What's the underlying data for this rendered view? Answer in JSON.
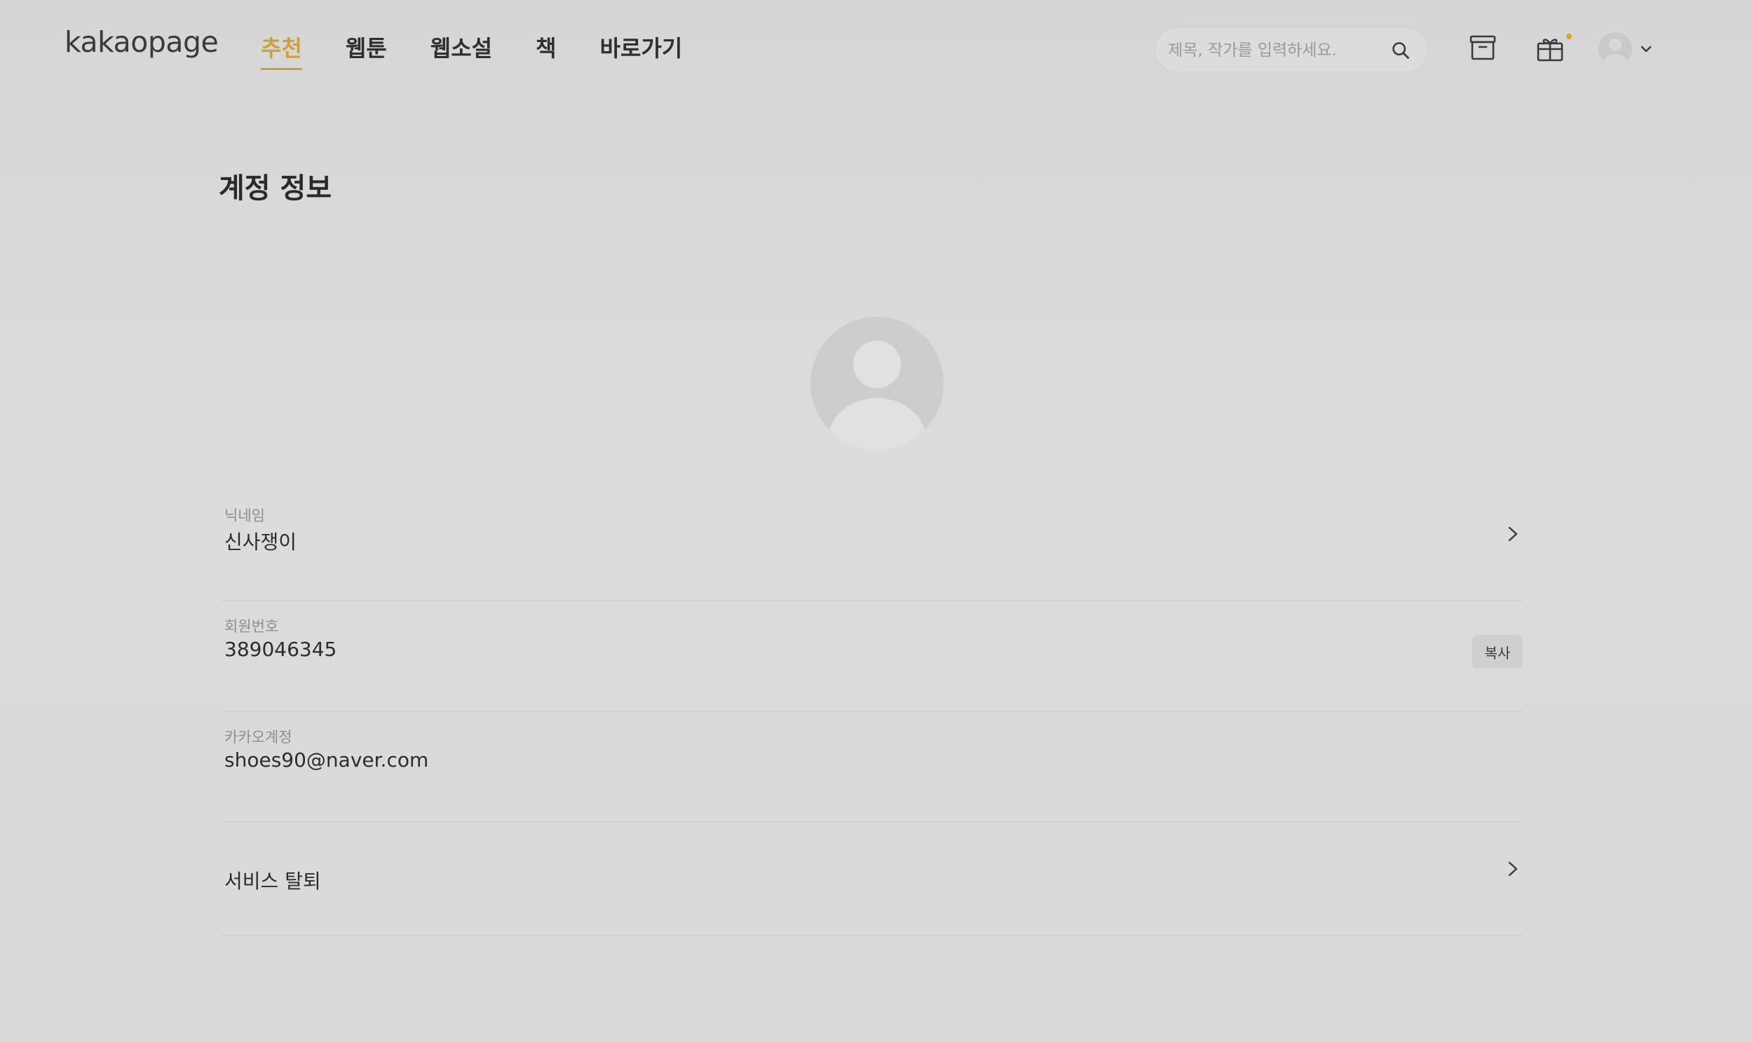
{
  "header": {
    "logo": "kakaopage",
    "nav": [
      {
        "label": "추천",
        "active": true
      },
      {
        "label": "웹툰",
        "active": false
      },
      {
        "label": "웹소설",
        "active": false
      },
      {
        "label": "책",
        "active": false
      },
      {
        "label": "바로가기",
        "active": false
      }
    ],
    "search": {
      "placeholder": "제목, 작가를 입력하세요.",
      "icon": "search-icon"
    },
    "icons": [
      "archive-icon",
      "gift-icon",
      "avatar",
      "chevron-down-icon"
    ]
  },
  "page": {
    "title": "계정 정보"
  },
  "account": {
    "nickname": {
      "label": "닉네임",
      "value": "신사쟁이"
    },
    "member_no": {
      "label": "회원번호",
      "value": "389046345",
      "copy_label": "복사"
    },
    "kakao": {
      "label": "카카오계정",
      "value": "shoes90@naver.com"
    },
    "withdraw": {
      "label": "서비스 탈퇴"
    }
  },
  "colors": {
    "accent": "#c9a23a",
    "background": "#d9d9d9",
    "text": "#2a2a2a",
    "muted": "#8e8e8e"
  }
}
